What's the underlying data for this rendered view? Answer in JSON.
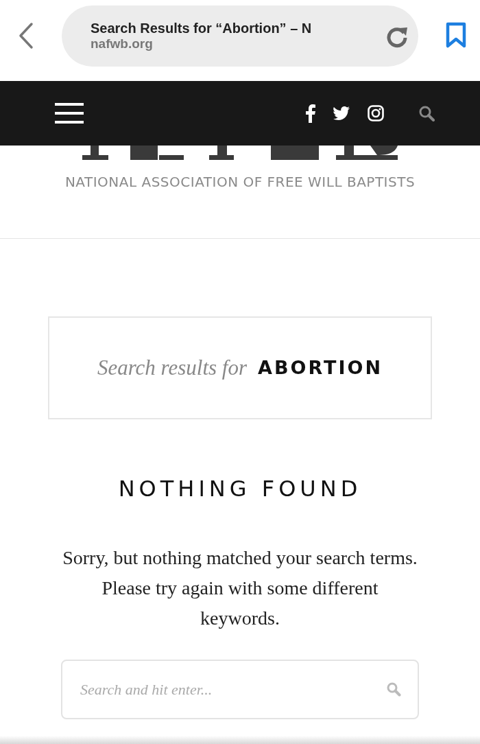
{
  "browser": {
    "page_title": "Search Results for “Abortion” – N",
    "domain": "nafwb.org"
  },
  "site": {
    "tagline": "NATIONAL ASSOCIATION OF FREE WILL BAPTISTS"
  },
  "search_header": {
    "label": "Search results for",
    "query": "ABORTION"
  },
  "heading": "NOTHING FOUND",
  "message": "Sorry, but nothing matched your search terms. Please try again with some different keywords.",
  "search_field": {
    "placeholder": "Search and hit enter..."
  }
}
